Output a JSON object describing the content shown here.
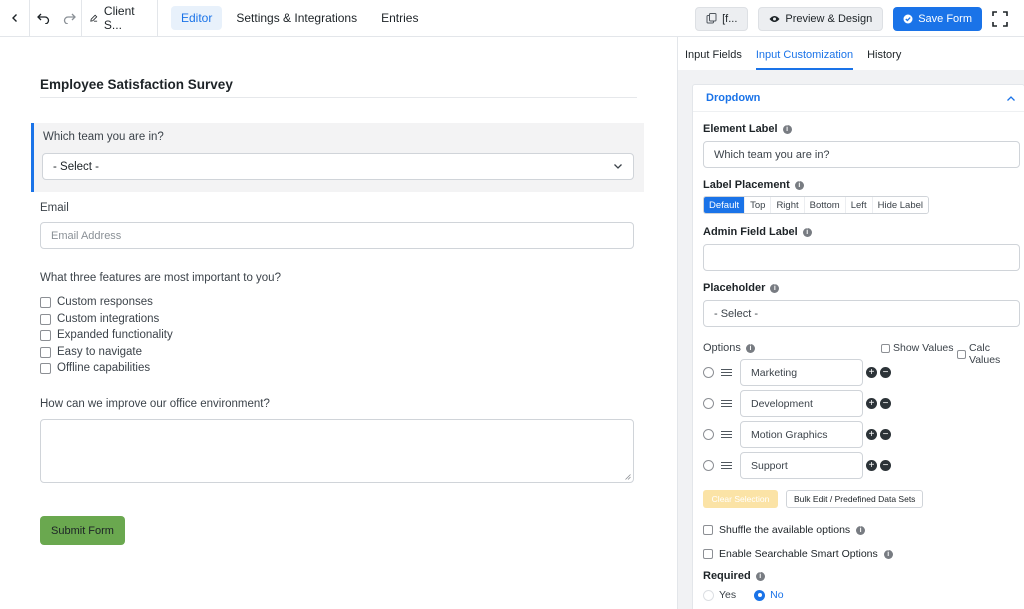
{
  "topbar": {
    "form_name": "Client S...",
    "tabs": [
      "Editor",
      "Settings & Integrations",
      "Entries"
    ],
    "shortcode_label": "[f...",
    "preview_label": "Preview & Design",
    "save_label": "Save Form"
  },
  "form": {
    "title": "Employee Satisfaction Survey",
    "team_question": "Which team you are in?",
    "team_select_value": "- Select -",
    "email_label": "Email",
    "email_placeholder": "Email Address",
    "features_question": "What three features are most important to you?",
    "features": [
      "Custom responses",
      "Custom integrations",
      "Expanded functionality",
      "Easy to navigate",
      "Offline capabilities"
    ],
    "office_question": "How can we improve our office environment?",
    "submit_label": "Submit Form"
  },
  "panel": {
    "tabs": [
      "Input Fields",
      "Input Customization",
      "History"
    ],
    "section_title": "Dropdown",
    "element_label": "Element Label",
    "element_label_value": "Which team you are in?",
    "label_placement": "Label Placement",
    "placement_options": [
      "Default",
      "Top",
      "Right",
      "Bottom",
      "Left",
      "Hide Label"
    ],
    "admin_label": "Admin Field Label",
    "placeholder_label": "Placeholder",
    "placeholder_value": "- Select -",
    "options_label": "Options",
    "show_values": "Show Values",
    "calc_values": "Calc Values",
    "options": [
      "Marketing",
      "Development",
      "Motion Graphics",
      "Support"
    ],
    "clear_selection": "Clear Selection",
    "bulk_edit": "Bulk Edit / Predefined Data Sets",
    "shuffle": "Shuffle the available options",
    "searchable": "Enable Searchable Smart Options",
    "required_label": "Required",
    "yes": "Yes",
    "no": "No",
    "info_glyph": "i"
  },
  "colors": {
    "accent": "#1a73e8",
    "submit": "#6aa84f",
    "clear": "#fbe3a6"
  }
}
